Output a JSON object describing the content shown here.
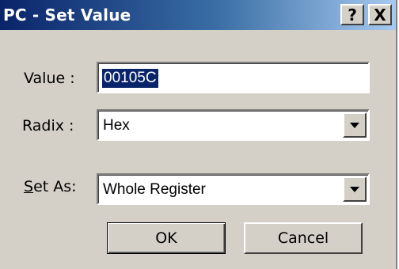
{
  "window": {
    "title": "PC - Set Value",
    "help_label": "?",
    "close_label": "X"
  },
  "form": {
    "value_label": "Value :",
    "value": "00105C",
    "radix_label": "Radix :",
    "radix_selected": "Hex",
    "setas_label_underlined": "S",
    "setas_label_rest": "et As:",
    "setas_selected": "Whole Register"
  },
  "buttons": {
    "ok_label": "OK",
    "cancel_label": "Cancel"
  }
}
